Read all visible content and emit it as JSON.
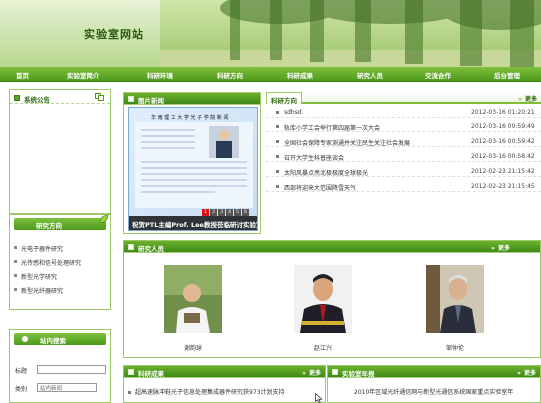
{
  "header": {
    "site_title": "实验室网站"
  },
  "nav": {
    "items": [
      "首页",
      "实验室简介",
      "科研环境",
      "科研方向",
      "科研成果",
      "研究人员",
      "交流合作",
      "后台管理"
    ]
  },
  "notice": {
    "title": "系统公告"
  },
  "directions": {
    "title": "研究方向",
    "items": [
      "光电子器件研究",
      "光传感和信号处理研究",
      "新型光学研究",
      "新型光纤器研究"
    ]
  },
  "search": {
    "title": "站内搜索",
    "keyword_label": "标题",
    "keyword_value": "",
    "category_label": "类别",
    "category_value": "站内新闻"
  },
  "photo_news": {
    "title": "图片新闻",
    "doc_title": "华 南 理 工 大 学 光 子 学 院 新 闻",
    "caption": "祝贺PTL主编Prof. Lee教授莅临研讨实验室",
    "pager": [
      "1",
      "2",
      "3",
      "4",
      "5",
      "6"
    ],
    "active_page": "1"
  },
  "research_list": {
    "tab": "科研方向",
    "more": "更多",
    "rows": [
      {
        "title": "sdhsd",
        "date": "2012-03-16 01:20:21"
      },
      {
        "title": "轨库小学工会举行第四届第一次大会",
        "date": "2012-03-16 00:59:49"
      },
      {
        "title": "全国社会保障专家测通并关注民生关注社会发展",
        "date": "2012-03-16 00:59:42"
      },
      {
        "title": "召开大学生科普座谈会",
        "date": "2012-03-16 00:58:42"
      },
      {
        "title": "太阳风暴点亮北极极度全球极光",
        "date": "2012-02-23 21:15:42"
      },
      {
        "title": "西部将迎来大范围降雪天气",
        "date": "2012-02-23 21:15:45"
      }
    ]
  },
  "people": {
    "title": "研究人员",
    "more": "更多",
    "members": [
      {
        "name": "谢韵球"
      },
      {
        "name": "赵江兴"
      },
      {
        "name": "邹仲伦"
      }
    ]
  },
  "achievements": {
    "title": "科研成果",
    "more": "更多",
    "first_item": "超高速脉冲鞋光子信息处理集成器件研究获973计划支持"
  },
  "lab_news": {
    "title": "实验室年报",
    "more": "更多",
    "first_item": "2010年区域光纤通信网与新型光通信系统国家重点实验室年"
  },
  "colors": {
    "nav_green": "#4e9a1e",
    "accent_green": "#7fbf3a",
    "panel_border": "#9cc86a",
    "title_green": "#2d5a10"
  }
}
